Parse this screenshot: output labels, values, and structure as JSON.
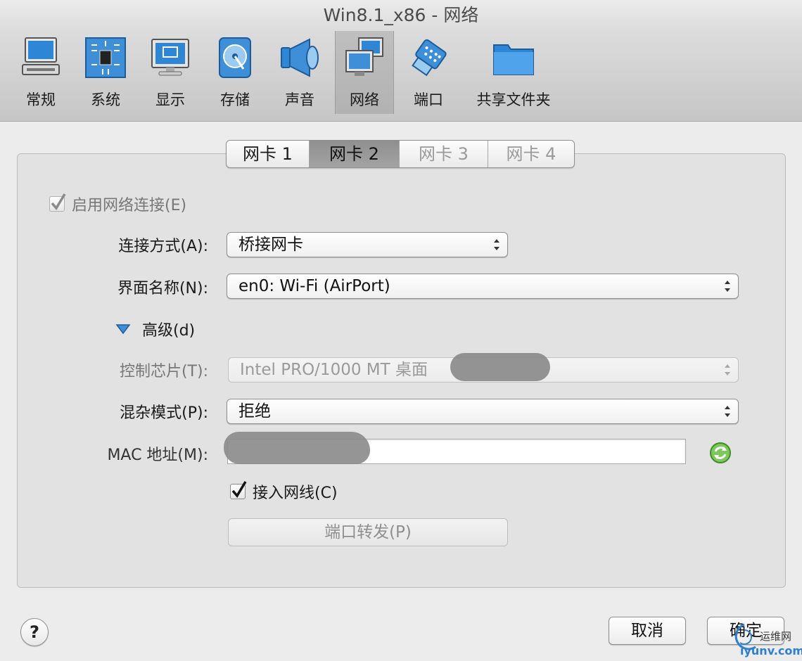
{
  "window": {
    "title": "Win8.1_x86 - 网络"
  },
  "toolbar": {
    "items": [
      {
        "label": "常规",
        "icon": "computer-icon"
      },
      {
        "label": "系统",
        "icon": "chip-icon"
      },
      {
        "label": "显示",
        "icon": "monitor-icon"
      },
      {
        "label": "存储",
        "icon": "disk-icon"
      },
      {
        "label": "声音",
        "icon": "speaker-icon"
      },
      {
        "label": "网络",
        "icon": "network-icon",
        "selected": true
      },
      {
        "label": "端口",
        "icon": "serial-port-icon"
      },
      {
        "label": "共享文件夹",
        "icon": "folder-icon"
      }
    ]
  },
  "adapter_tabs": [
    {
      "label": "网卡 1",
      "state": "normal"
    },
    {
      "label": "网卡 2",
      "state": "selected"
    },
    {
      "label": "网卡 3",
      "state": "disabled"
    },
    {
      "label": "网卡 4",
      "state": "disabled"
    }
  ],
  "form": {
    "enable_label": "启用网络连接(E)",
    "enable_checked": true,
    "attached_label": "连接方式(A):",
    "attached_value": "桥接网卡",
    "name_label": "界面名称(N):",
    "name_value": "en0: Wi-Fi (AirPort)",
    "advanced_label": "高级(d)",
    "adapter_type_label": "控制芯片(T):",
    "adapter_type_value": "Intel PRO/1000 MT 桌面",
    "promisc_label": "混杂模式(P):",
    "promisc_value": "拒绝",
    "mac_label": "MAC 地址(M):",
    "mac_value": "",
    "cable_label": "接入网线(C)",
    "cable_checked": true,
    "port_forward_label": "端口转发(P)"
  },
  "footer": {
    "help_label": "?",
    "cancel_label": "取消",
    "ok_label": "确定"
  },
  "watermark": {
    "site": "运维网",
    "url": "iyunv.com"
  },
  "colors": {
    "accent_blue": "#3e8fd8",
    "refresh_green": "#5cb83a"
  }
}
